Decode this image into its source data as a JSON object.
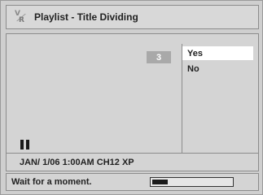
{
  "title_bar": {
    "icon": "vr-icon",
    "vr_icon_top": "V",
    "vr_icon_bottom": "R",
    "title": "Playlist - Title Dividing"
  },
  "preview": {
    "count": "3",
    "pause_icon": "pause-icon"
  },
  "menu": {
    "items": [
      {
        "label": "Yes",
        "selected": true
      },
      {
        "label": "No",
        "selected": false
      }
    ]
  },
  "info": {
    "text": "JAN/ 1/06 1:00AM CH12 XP"
  },
  "status": {
    "message": "Wait for a moment.",
    "progress": 0.2
  },
  "colors": {
    "background": "#cfcfcf",
    "highlight": "#ffffff",
    "badge": "#a9a9a9"
  }
}
